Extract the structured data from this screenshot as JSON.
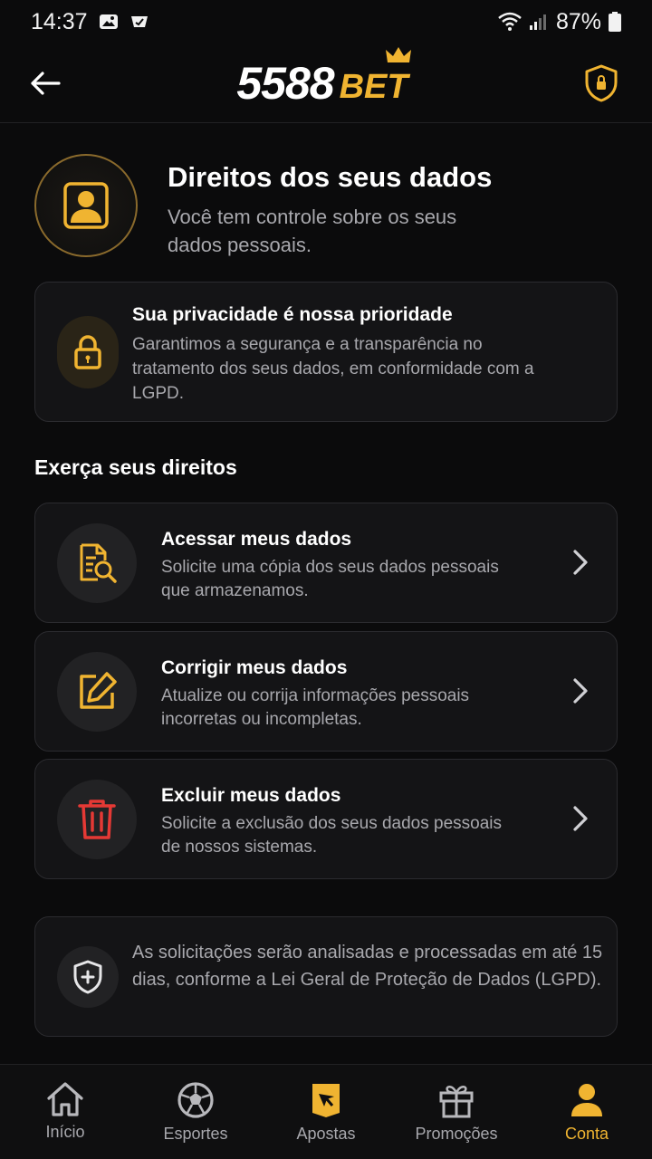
{
  "status_bar": {
    "time": "14:37",
    "battery": "87%"
  },
  "header": {
    "logo_number": "5588",
    "logo_bet": "BET"
  },
  "hero": {
    "title": "Direitos dos seus dados",
    "subtitle": "Você tem controle sobre os seus dados pessoais."
  },
  "privacy": {
    "title": "Sua privacidade é nossa prioridade",
    "text": "Garantimos a segurança e a transparência no tratamento dos seus dados, em conformidade com a LGPD."
  },
  "rights_section": {
    "title": "Exerça seus direitos",
    "items": [
      {
        "title": "Acessar meus dados",
        "description": "Solicite uma cópia dos seus dados pessoais que armazenamos.",
        "icon": "document-search-icon"
      },
      {
        "title": "Corrigir meus dados",
        "description": "Atualize ou corrija informações pessoais incorretas ou incompletas.",
        "icon": "edit-icon"
      },
      {
        "title": "Excluir meus dados",
        "description": "Solicite a exclusão dos seus dados pessoais de nossos sistemas.",
        "icon": "trash-icon"
      }
    ]
  },
  "info": {
    "text": "As solicitações serão analisadas e processadas em até 15 dias, conforme a Lei Geral de Proteção de Dados (LGPD)."
  },
  "bottom_nav": {
    "items": [
      {
        "label": "Início",
        "icon": "home-icon"
      },
      {
        "label": "Esportes",
        "icon": "soccer-ball-icon"
      },
      {
        "label": "Apostas",
        "icon": "bet-ticket-icon"
      },
      {
        "label": "Promoções",
        "icon": "gift-icon"
      },
      {
        "label": "Conta",
        "icon": "user-icon",
        "active": true
      }
    ]
  },
  "colors": {
    "accent": "#f0b431",
    "danger": "#e53935",
    "background": "#0b0b0c",
    "card": "#141416"
  }
}
